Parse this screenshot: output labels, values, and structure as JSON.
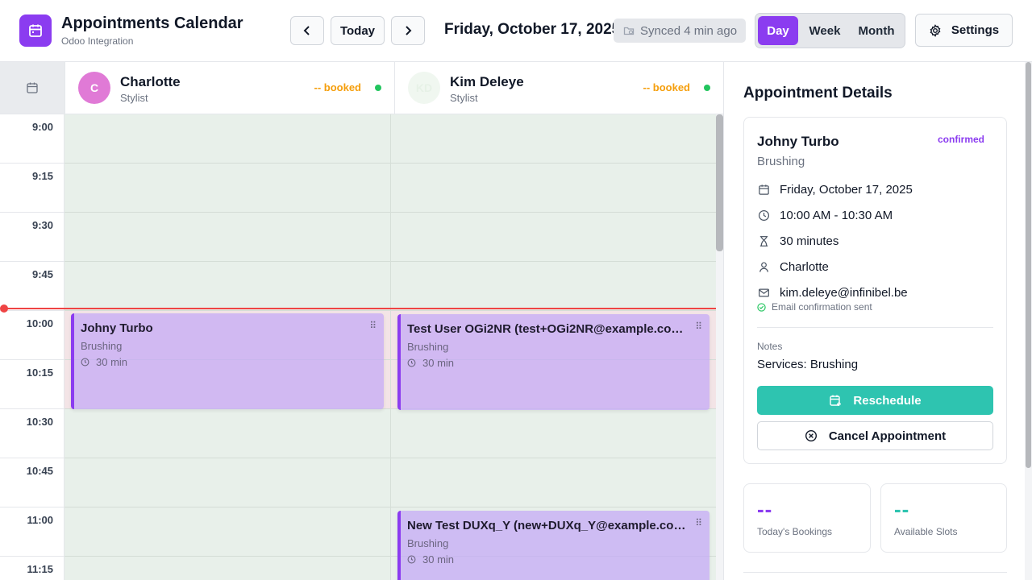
{
  "app": {
    "title": "Appointments Calendar",
    "subtitle": "Odoo Integration",
    "accent": "#8b3cf0",
    "teal": "#2ec4b0"
  },
  "nav": {
    "prev_icon": "chevron-left-icon",
    "today_label": "Today",
    "next_icon": "chevron-right-icon",
    "current_date": "Friday, October 17, 2025",
    "sync_status": "Synced 4 min ago",
    "views": [
      "Day",
      "Week",
      "Month"
    ],
    "active_view": "Day",
    "settings_label": "Settings"
  },
  "staff": [
    {
      "initials": "C",
      "name": "Charlotte",
      "role": "Stylist",
      "booked": "-- booked",
      "status_color": "#22c55e"
    },
    {
      "initials": "KD",
      "name": "Kim Deleye",
      "role": "Stylist",
      "booked": "-- booked",
      "status_color": "#22c55e"
    }
  ],
  "time_slots": [
    "9:00",
    "9:15",
    "9:30",
    "9:45",
    "10:00",
    "10:15",
    "10:30",
    "10:45",
    "11:00",
    "11:15"
  ],
  "appointments": [
    {
      "staff": "Charlotte",
      "title": "Johny Turbo",
      "service": "Brushing",
      "duration": "30 min",
      "start": "10:00"
    },
    {
      "staff": "Kim Deleye",
      "title": "Test User OGi2NR (test+OGi2NR@example.com, ...",
      "service": "Brushing",
      "duration": "30 min",
      "start": "10:00"
    },
    {
      "staff": "Kim Deleye",
      "title": "New Test DUXq_Y (new+DUXq_Y@example.com, ...",
      "service": "Brushing",
      "duration": "30 min",
      "start": "11:00"
    }
  ],
  "details": {
    "heading": "Appointment Details",
    "client": "Johny Turbo",
    "status": "confirmed",
    "service": "Brushing",
    "date": "Friday, October 17, 2025",
    "time": "10:00 AM - 10:30 AM",
    "duration": "30 minutes",
    "staff": "Charlotte",
    "email": "kim.deleye@infinibel.be",
    "email_note": "Email confirmation sent",
    "notes_label": "Notes",
    "notes": "Services: Brushing",
    "reschedule_label": "Reschedule",
    "cancel_label": "Cancel Appointment"
  },
  "stats": [
    {
      "value": "--",
      "label": "Today's Bookings"
    },
    {
      "value": "--",
      "label": "Available Slots"
    }
  ]
}
